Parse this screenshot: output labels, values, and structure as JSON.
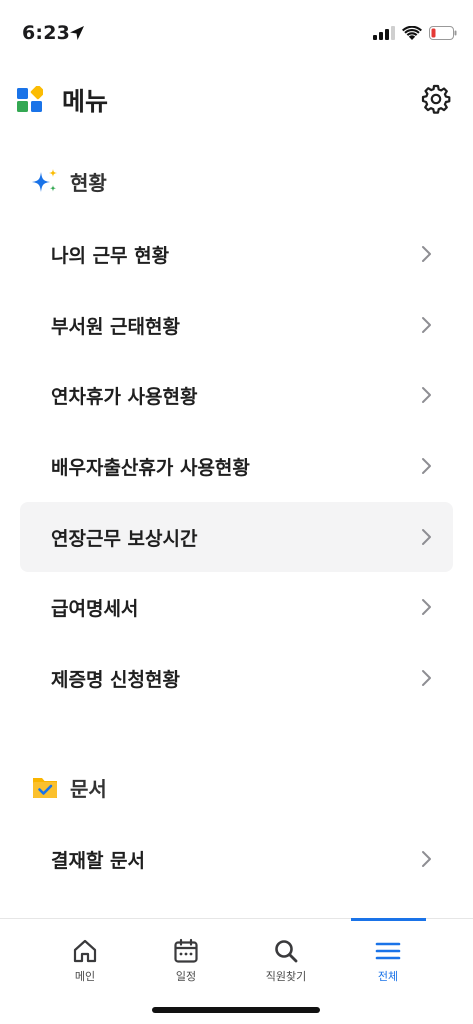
{
  "status": {
    "time": "6:23"
  },
  "header": {
    "title": "메뉴"
  },
  "sections": [
    {
      "label": "현황",
      "icon": "sparkle-icon",
      "items": [
        {
          "label": "나의 근무 현황"
        },
        {
          "label": "부서원 근태현황"
        },
        {
          "label": "연차휴가 사용현황"
        },
        {
          "label": "배우자출산휴가 사용현황"
        },
        {
          "label": "연장근무 보상시간",
          "highlighted": true
        },
        {
          "label": "급여명세서"
        },
        {
          "label": "제증명 신청현황"
        }
      ]
    },
    {
      "label": "문서",
      "icon": "folder-check-icon",
      "items": [
        {
          "label": "결재할 문서"
        }
      ]
    }
  ],
  "tabbar": {
    "tabs": [
      {
        "label": "메인",
        "icon": "home-icon"
      },
      {
        "label": "일정",
        "icon": "calendar-icon"
      },
      {
        "label": "직원찾기",
        "icon": "search-icon"
      },
      {
        "label": "전체",
        "icon": "hamburger-menu-icon",
        "active": true
      }
    ]
  },
  "colors": {
    "accent": "#1a73e8",
    "highlight_bg": "#f4f4f5",
    "battery_low": "#e53935"
  }
}
